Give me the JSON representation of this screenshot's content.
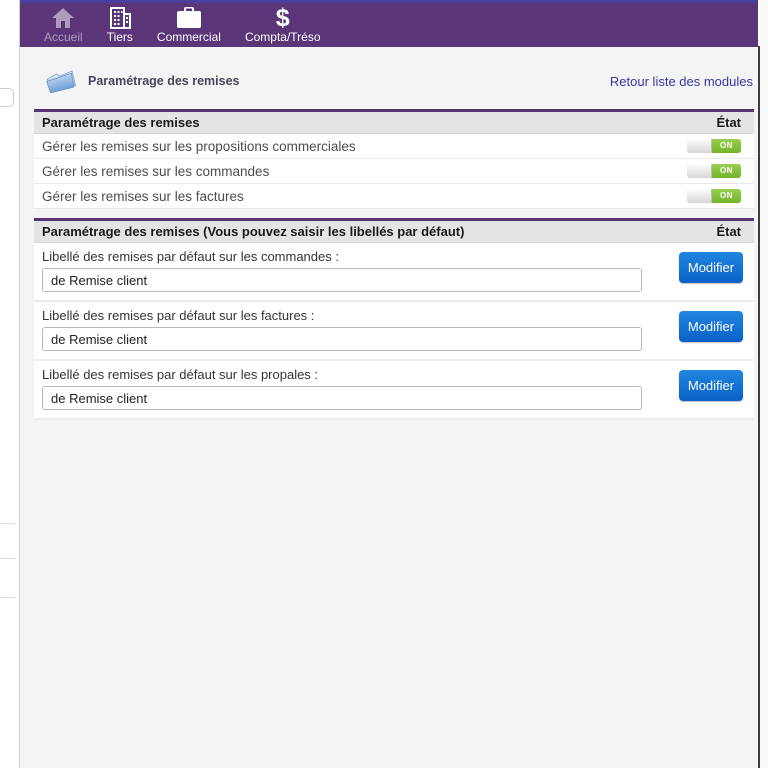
{
  "nav": {
    "items": [
      {
        "label": "Accueil",
        "icon": "home-icon",
        "faded": true
      },
      {
        "label": "Tiers",
        "icon": "building-icon",
        "faded": false
      },
      {
        "label": "Commercial",
        "icon": "briefcase-icon",
        "faded": false
      },
      {
        "label": "Compta/Tréso",
        "icon": "dollar-icon",
        "faded": false
      }
    ]
  },
  "header": {
    "title": "Paramétrage des remises",
    "back_link": "Retour liste des modules"
  },
  "toggles_table": {
    "title": "Paramétrage des remises",
    "state_column": "État",
    "rows": [
      {
        "label": "Gérer les remises sur les propositions commerciales",
        "state": "ON"
      },
      {
        "label": "Gérer les remises sur les commandes",
        "state": "ON"
      },
      {
        "label": "Gérer les remises sur les factures",
        "state": "ON"
      }
    ]
  },
  "labels_table": {
    "title": "Paramétrage des remises (Vous pouvez saisir les libellés par défaut)",
    "state_column": "État",
    "rows": [
      {
        "label": "Libellé des remises par défaut sur les commandes :",
        "value": "de Remise client",
        "button": "Modifier"
      },
      {
        "label": "Libellé des remises par défaut sur les factures :",
        "value": "de Remise client",
        "button": "Modifier"
      },
      {
        "label": "Libellé des remises par défaut sur les propales :",
        "value": "de Remise client",
        "button": "Modifier"
      }
    ]
  },
  "colors": {
    "navbar": "#5a3578",
    "topline": "#4a3f9e",
    "panel_border": "#553472",
    "toggle_on_green": "#74b42a",
    "button_blue": "#0a61c9",
    "link_blue": "#3636a8"
  }
}
